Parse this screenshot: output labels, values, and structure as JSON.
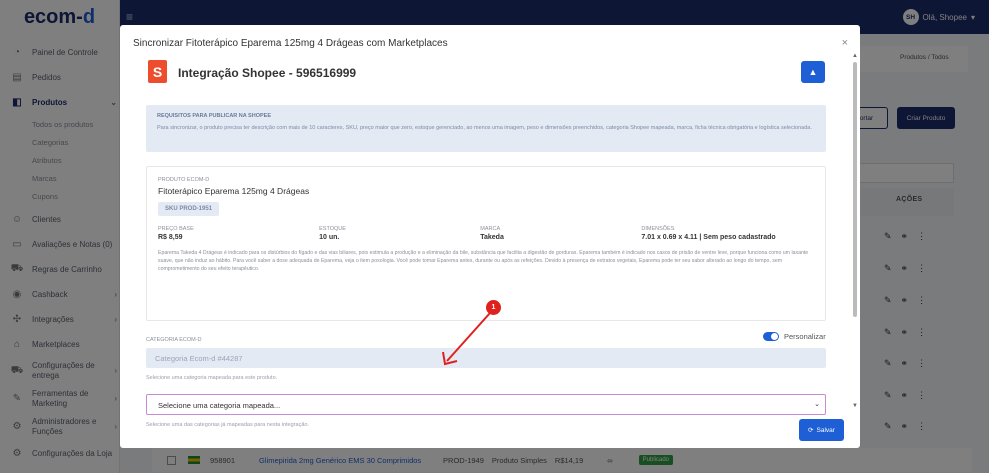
{
  "app": {
    "logo_text": "ecom-",
    "logo_accent": "d",
    "user_initials": "SH",
    "user_greeting": "Olá, Shopee",
    "user_caret": "▾",
    "menu_icon": "menu-icon"
  },
  "sidebar": {
    "items": [
      {
        "label": "Painel de Controle",
        "icon": "dashboard-icon"
      },
      {
        "label": "Pedidos",
        "icon": "orders-icon"
      },
      {
        "label": "Produtos",
        "icon": "products-icon"
      },
      {
        "label": "Clientes",
        "icon": "customers-icon"
      },
      {
        "label": "Avaliações e Notas (0)",
        "icon": "reviews-icon"
      },
      {
        "label": "Regras de Carrinho",
        "icon": "cart-icon"
      },
      {
        "label": "Cashback",
        "icon": "cashback-icon"
      },
      {
        "label": "Integrações",
        "icon": "integrations-icon"
      },
      {
        "label": "Marketplaces",
        "icon": "marketplaces-icon"
      },
      {
        "label": "Configurações de entrega",
        "icon": "shipping-icon"
      },
      {
        "label": "Ferramentas de Marketing",
        "icon": "marketing-icon"
      },
      {
        "label": "Administradores e Funções",
        "icon": "admins-icon"
      },
      {
        "label": "Configurações da Loja",
        "icon": "store-settings-icon"
      }
    ],
    "subitems": [
      "Todos os produtos",
      "Categorias",
      "Atributos",
      "Marcas",
      "Cupons"
    ]
  },
  "background": {
    "breadcrumb": "Produtos  /  Todos",
    "import_label": "ortar",
    "create_label": "Criar Produto",
    "actions_header": "AÇÕES",
    "row": {
      "id": "958901",
      "name": "Glimepirida 2mg Genérico EMS 30 Comprimidos",
      "sku": "PROD-1949",
      "type": "Produto Simples",
      "price": "R$14,19",
      "stock": "∞",
      "status": "Publicado"
    }
  },
  "modal": {
    "title": "Sincronizar Fitoterápico Eparema 125mg 4 Drágeas com Marketplaces",
    "close": "×",
    "integration_title": "Integração Shopee - 596516999",
    "shopee_glyph": "S",
    "requirements_heading": "REQUISITOS PARA PUBLICAR NA SHOPEE",
    "requirements_text": "Para sincronizar, o produto precisa ter descrição com mais de 10 caracteres, SKU, preço maior que zero, estoque gerenciado, ao menos uma imagem, peso e dimensões preenchidos, categoria Shopee mapeada, marca, ficha técnica obrigatória e logística selecionada.",
    "product_label": "PRODUTO ECOM-D",
    "product_name": "Fitoterápico Eparema 125mg 4 Drágeas",
    "sku": "SKU PROD-1951",
    "price_label": "PREÇO BASE",
    "price_value": "R$ 8,59",
    "stock_label": "ESTOQUE",
    "stock_value": "10 un.",
    "brand_label": "MARCA",
    "brand_value": "Takeda",
    "dims_label": "DIMENSÕES",
    "dims_value": "7.01 x 0.69 x 4.11 | Sem peso cadastrado",
    "description": "Eparema Takeda 4 Drágeas é indicado para os distúrbios do fígado e das vias biliares, pois estimula a produção e a eliminação da bile, substância que facilita a digestão de gorduras. Eparema também é indicado nos casos de prisão de ventre leve, porque funciona como um laxante suave, que não induz ao hábito. Para você saber a dose adequada de Eparema, veja o item posologia. Você pode tomar Eparema antes, durante ou após as refeições. Devido à presença de extratos vegetais, Eparema pode ter seu sabor alterado ao longo do tempo, sem comprometimento do seu efeito terapêutico.",
    "category_label": "CATEGORIA ECOM-D",
    "customize_label": "Personalizar",
    "customize_on": true,
    "category_value": "Categoria Ecom-d #44287",
    "category_hint": "Selecione uma categoria mapeada para este produto.",
    "mapped_select": "Selecione uma categoria mapeada...",
    "mapped_hint": "Selecione uma das categorias já mapeadas para nesta integração.",
    "save_label": "Salvar",
    "marker_number": "1"
  },
  "colors": {
    "brand_navy": "#1d2c6b",
    "accent_blue": "#1e5fd6",
    "shopee_orange": "#ee4d2d",
    "marker_red": "#e0201c"
  }
}
